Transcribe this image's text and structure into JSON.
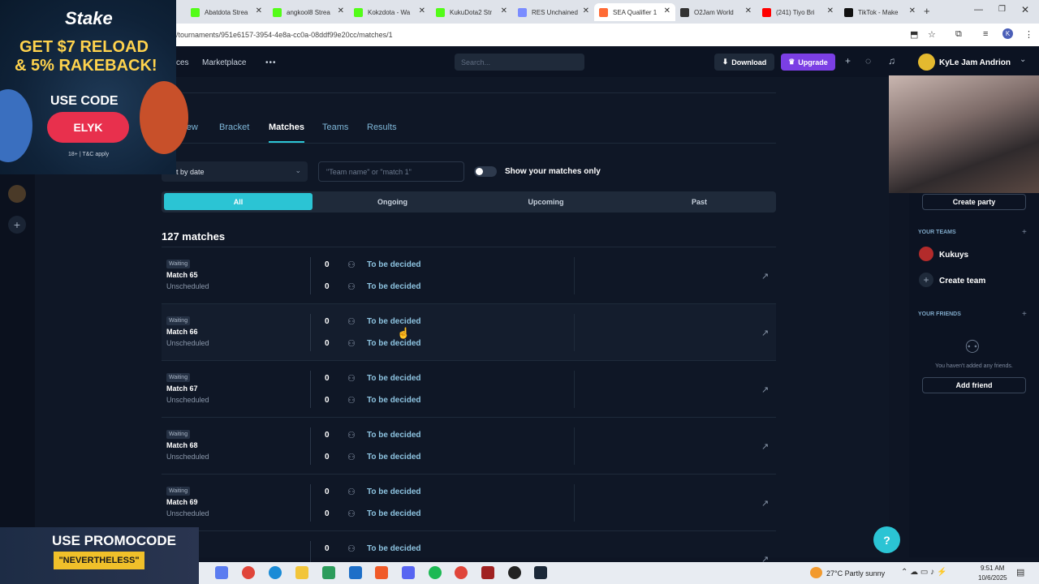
{
  "browser": {
    "tabs": [
      {
        "label": "Abatdota Strea",
        "color": "#53fc18"
      },
      {
        "label": "angkool8 Strea",
        "color": "#53fc18"
      },
      {
        "label": "Kokzdota - Wa",
        "color": "#53fc18"
      },
      {
        "label": "KukuDota2 Str",
        "color": "#53fc18"
      },
      {
        "label": "RES Unchained",
        "color": "#7a8cff"
      },
      {
        "label": "SEA Qualifier 1",
        "color": "#ff6b35"
      },
      {
        "label": "O2Jam World",
        "color": "#333333"
      },
      {
        "label": "(241) Tiyo Bri",
        "color": "#ff0000"
      },
      {
        "label": "TikTok - Make",
        "color": "#111111"
      }
    ],
    "url": "/tournaments/951e6157-3954-4e8a-cc0a-08ddf99e20cc/matches/1"
  },
  "header": {
    "nav_partial": "ces",
    "marketplace": "Marketplace",
    "more": "•••",
    "search_placeholder": "Search...",
    "download": "Download",
    "upgrade": "Upgrade",
    "username": "KyLe Jam Andrion"
  },
  "subtabs": {
    "overview": "erview",
    "bracket": "Bracket",
    "matches": "Matches",
    "teams": "Teams",
    "results": "Results"
  },
  "filters": {
    "sort": "ort by date",
    "team_placeholder": "\"Team name\" or \"match 1\"",
    "show_mine": "Show your matches only",
    "all": "All",
    "ongoing": "Ongoing",
    "upcoming": "Upcoming",
    "past": "Past"
  },
  "match_count": "127 matches",
  "matches": [
    {
      "status": "Waiting",
      "name": "Match 65",
      "schedule": "Unscheduled",
      "score1": "0",
      "team1": "To be decided",
      "score2": "0",
      "team2": "To be decided"
    },
    {
      "status": "Waiting",
      "name": "Match 66",
      "schedule": "Unscheduled",
      "score1": "0",
      "team1": "To be decided",
      "score2": "0",
      "team2": "To be decided"
    },
    {
      "status": "Waiting",
      "name": "Match 67",
      "schedule": "Unscheduled",
      "score1": "0",
      "team1": "To be decided",
      "score2": "0",
      "team2": "To be decided"
    },
    {
      "status": "Waiting",
      "name": "Match 68",
      "schedule": "Unscheduled",
      "score1": "0",
      "team1": "To be decided",
      "score2": "0",
      "team2": "To be decided"
    },
    {
      "status": "Waiting",
      "name": "Match 69",
      "schedule": "Unscheduled",
      "score1": "0",
      "team1": "To be decided",
      "score2": "0",
      "team2": "To be decided"
    },
    {
      "score1": "0",
      "team1": "To be decided"
    }
  ],
  "sidebar": {
    "create_party": "Create party",
    "your_teams": "YOUR TEAMS",
    "team_name": "Kukuys",
    "create_team": "Create team",
    "your_friends": "YOUR FRIENDS",
    "no_friends": "You haven't added any friends.",
    "add_friend": "Add friend"
  },
  "ads": {
    "stake_brand": "Stake",
    "stake_line1": "GET $7 RELOAD",
    "stake_line2": "& 5% RAKEBACK!",
    "stake_code_label": "USE CODE",
    "stake_code": "ELYK",
    "stake_terms": "18+ | T&C apply",
    "promo_line1": "USE PROMOCODE",
    "promo_line2": "\"NEVERTHELESS\""
  },
  "taskbar": {
    "weather": "27°C  Partly sunny",
    "time": "9:51 AM",
    "date": "10/6/2025"
  }
}
